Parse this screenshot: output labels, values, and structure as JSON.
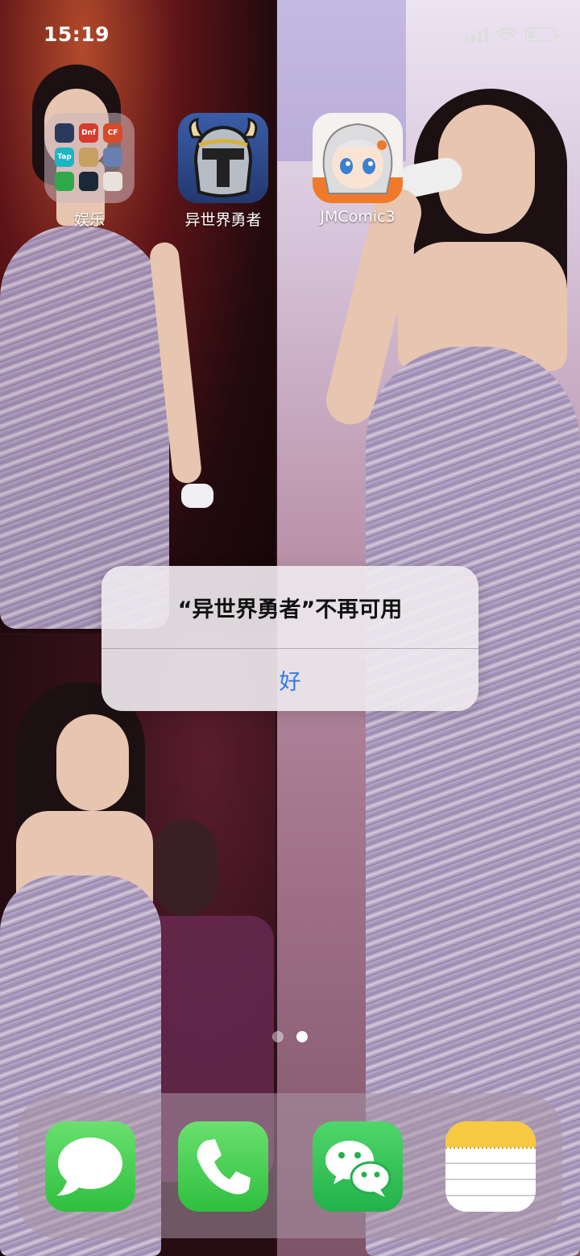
{
  "status_bar": {
    "time": "15:19",
    "signal_bars": 4,
    "battery_level": 0.2,
    "icons": [
      "cellular-signal-icon",
      "wifi-icon",
      "battery-icon"
    ]
  },
  "home_apps": [
    {
      "label": "娱乐",
      "type": "folder",
      "icon": "folder-icon"
    },
    {
      "label": "异世界勇者",
      "type": "app",
      "icon": "knight-helmet-icon"
    },
    {
      "label": "JMComic3",
      "type": "app",
      "icon": "anime-girl-icon"
    }
  ],
  "folder_minis": [
    {
      "color": "#2b3a5c",
      "text": ""
    },
    {
      "color": "#d63b2f",
      "text": "Dnf"
    },
    {
      "color": "#d94a2a",
      "text": "CF"
    },
    {
      "color": "#19b6c4",
      "text": "Tap"
    },
    {
      "color": "#c8a062",
      "text": ""
    },
    {
      "color": "#6a7fb0",
      "text": ""
    },
    {
      "color": "#2ea84a",
      "text": ""
    },
    {
      "color": "#1b2838",
      "text": ""
    },
    {
      "color": "#e8e2dc",
      "text": ""
    }
  ],
  "alert": {
    "title": "“异世界勇者”不再可用",
    "button": "好"
  },
  "page_indicator": {
    "count": 2,
    "active_index": 1
  },
  "dock": [
    {
      "name": "messages",
      "icon": "message-bubble-icon",
      "color": "#4cd964"
    },
    {
      "name": "phone",
      "icon": "phone-icon",
      "color": "#4cd964"
    },
    {
      "name": "wechat",
      "icon": "wechat-icon",
      "color": "#3ec55a"
    },
    {
      "name": "notes",
      "icon": "notes-icon",
      "color": "#f7d24a"
    }
  ]
}
